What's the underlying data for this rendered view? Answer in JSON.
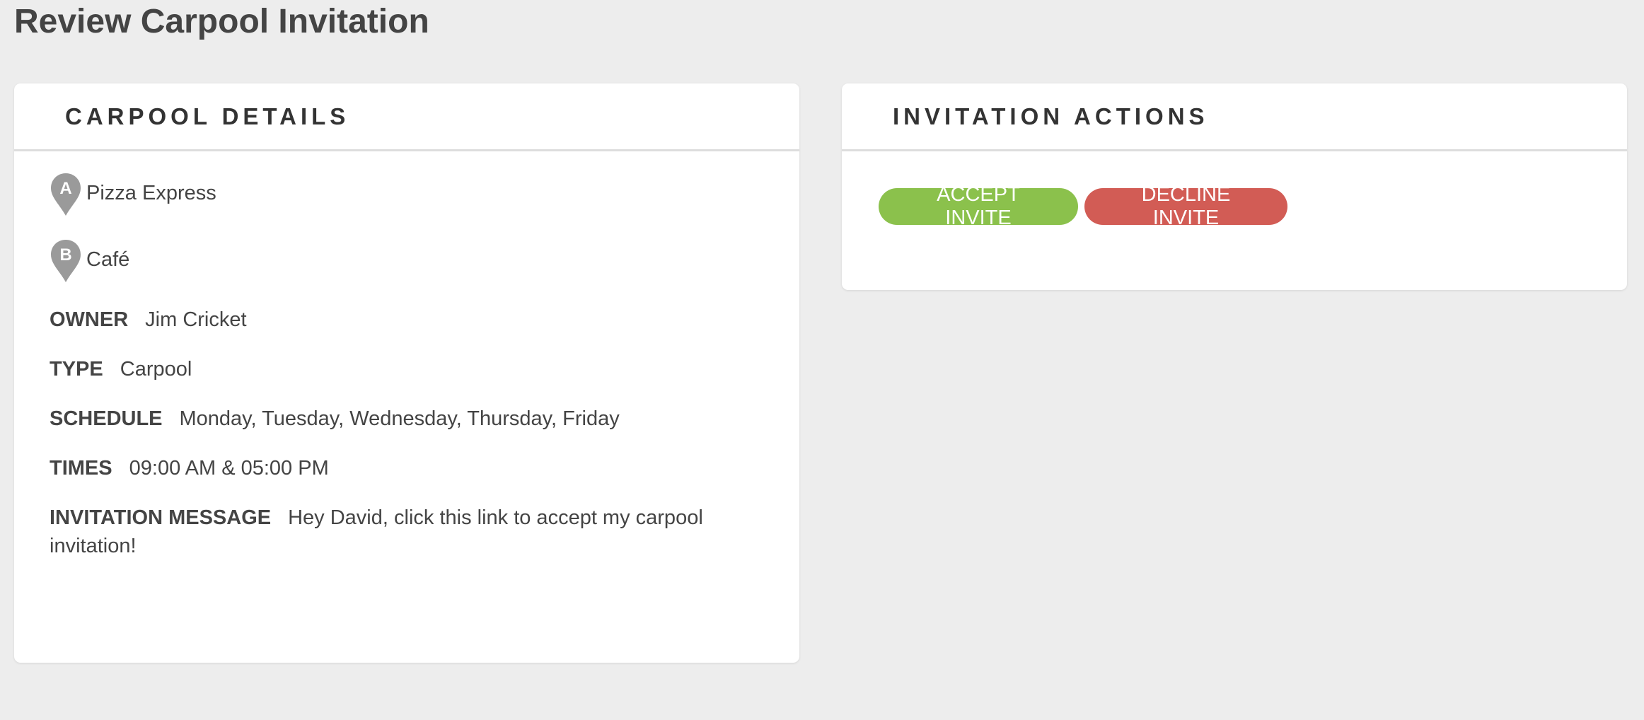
{
  "page": {
    "title": "Review Carpool Invitation"
  },
  "details": {
    "header": "CARPOOL DETAILS",
    "origin": {
      "marker": "A",
      "name": "Pizza Express"
    },
    "destination": {
      "marker": "B",
      "name": "Café"
    },
    "owner": {
      "label": "OWNER",
      "value": "Jim Cricket"
    },
    "type": {
      "label": "TYPE",
      "value": "Carpool"
    },
    "schedule": {
      "label": "SCHEDULE",
      "value": "Monday, Tuesday, Wednesday, Thursday, Friday"
    },
    "times": {
      "label": "TIMES",
      "value": "09:00 AM & 05:00 PM"
    },
    "message": {
      "label": "INVITATION MESSAGE",
      "value": "Hey David, click this link to accept my carpool invitation!"
    }
  },
  "actions": {
    "header": "INVITATION ACTIONS",
    "accept_label": "ACCEPT INVITE",
    "decline_label": "DECLINE INVITE"
  },
  "colors": {
    "accept": "#8bc14c",
    "decline": "#d25c55",
    "pin": "#9a9a9a",
    "background": "#ededed"
  },
  "icons": {
    "origin": "map-pin-a-icon",
    "destination": "map-pin-b-icon"
  }
}
